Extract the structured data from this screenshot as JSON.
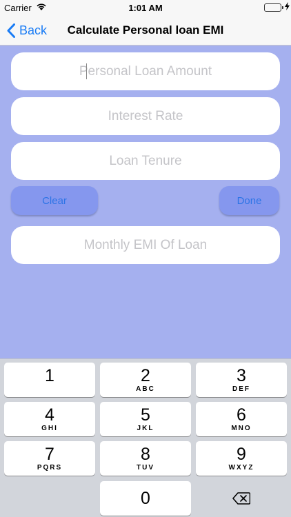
{
  "status_bar": {
    "carrier": "Carrier",
    "time": "1:01 AM",
    "battery_level": 1.0,
    "battery_color": "#4cd964"
  },
  "nav": {
    "back_label": "Back",
    "title": "Calculate Personal loan EMI",
    "accent_color": "#1a7cf5"
  },
  "form": {
    "loan_amount_placeholder": "Personal Loan Amount",
    "interest_rate_placeholder": "Interest Rate",
    "loan_tenure_placeholder": "Loan Tenure",
    "emi_result_placeholder": "Monthly EMI Of Loan",
    "clear_label": "Clear",
    "done_label": "Done"
  },
  "keyboard": {
    "keys": [
      {
        "digit": "1",
        "letters": ""
      },
      {
        "digit": "2",
        "letters": "ABC"
      },
      {
        "digit": "3",
        "letters": "DEF"
      },
      {
        "digit": "4",
        "letters": "GHI"
      },
      {
        "digit": "5",
        "letters": "JKL"
      },
      {
        "digit": "6",
        "letters": "MNO"
      },
      {
        "digit": "7",
        "letters": "PQRS"
      },
      {
        "digit": "8",
        "letters": "TUV"
      },
      {
        "digit": "9",
        "letters": "WXYZ"
      },
      {
        "digit": "0",
        "letters": ""
      }
    ],
    "delete_icon": "backspace-icon"
  },
  "colors": {
    "background": "#a5b0ef",
    "button_fill": "#8597ee",
    "button_text": "#2d74e6"
  }
}
